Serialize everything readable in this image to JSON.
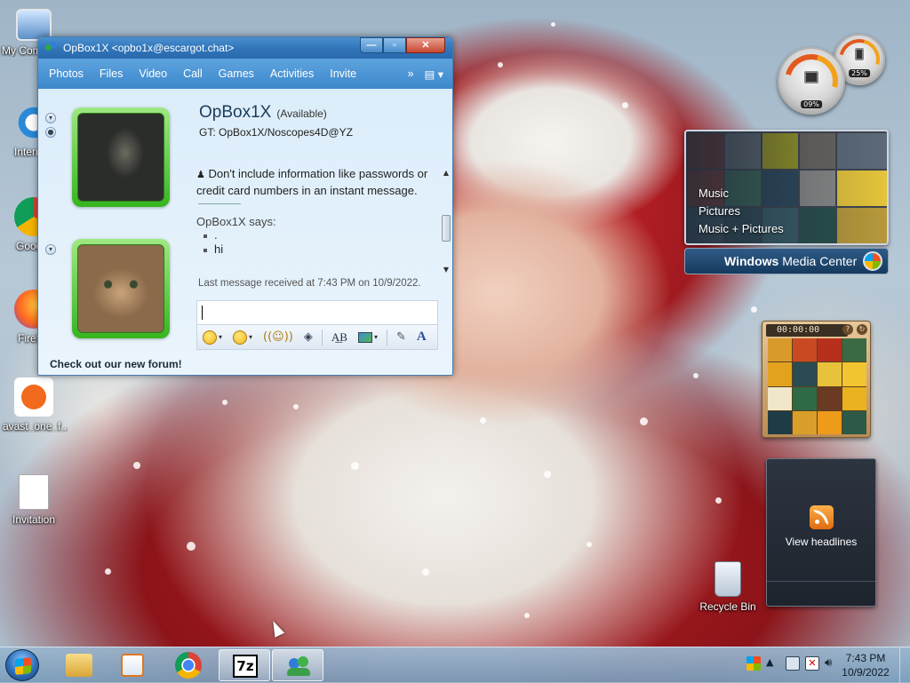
{
  "desktop": {
    "icons": [
      {
        "label": "My Computer"
      },
      {
        "label": "Internet Explorer"
      },
      {
        "label": "Google Chrome"
      },
      {
        "label": "Firefox"
      },
      {
        "label": "avast_one_f..."
      },
      {
        "label": "Invitation"
      },
      {
        "label": "Recycle Bin"
      }
    ]
  },
  "messenger": {
    "title": "OpBox1X <opbo1x@escargot.chat>",
    "menu": [
      "Photos",
      "Files",
      "Video",
      "Call",
      "Games",
      "Activities",
      "Invite"
    ],
    "menu_more": "»",
    "contact_name": "OpBox1X",
    "contact_status": "(Available)",
    "contact_gt": "GT: OpBox1X/Noscopes4D@YZ",
    "warning": "Don't include information like passwords or credit card numbers in an instant message.",
    "sender_line": "OpBox1X says:",
    "messages": [
      ".",
      "hi"
    ],
    "last_message": "Last message received at 7:43 PM on 10/9/2022.",
    "input_value": "",
    "footer": "Check out our new forum!"
  },
  "gadgets": {
    "cpu_percent": "09%",
    "mem_percent": "25%",
    "media_center": {
      "menu": [
        "Music",
        "Pictures",
        "Music + Pictures"
      ],
      "brand_a": "Windows",
      "brand_b": "Media Center"
    },
    "puzzle_timer": "00:00:00",
    "feed_label": "View headlines"
  },
  "taskbar": {
    "time": "7:43 PM",
    "date": "10/9/2022"
  }
}
